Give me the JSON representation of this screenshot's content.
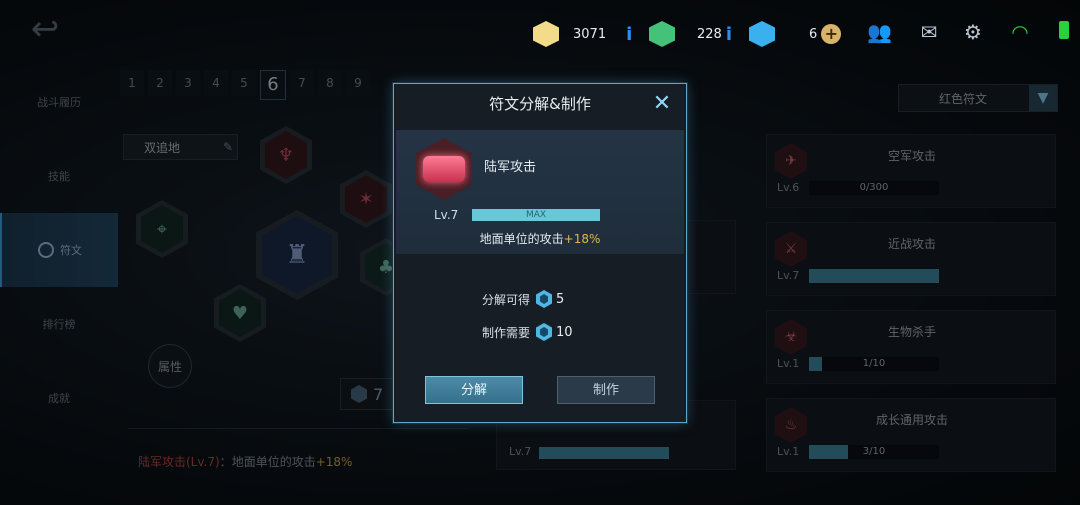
{
  "top_bar": {
    "gold_count": "3071",
    "jade_count": "228",
    "gem_count": "6",
    "info_glyph": "i",
    "icons": [
      "back-arrow-icon",
      "friends-icon",
      "mail-icon",
      "settings-gear-icon",
      "wifi-icon",
      "battery-icon"
    ]
  },
  "sidebar": {
    "items": [
      {
        "label": "战斗履历"
      },
      {
        "label": "技能"
      },
      {
        "label": "符文"
      },
      {
        "label": "排行榜"
      },
      {
        "label": "成就"
      }
    ],
    "active_index": 2
  },
  "pages": {
    "labels": [
      "1",
      "2",
      "3",
      "4",
      "5",
      "6",
      "7",
      "8",
      "9"
    ],
    "active": "6"
  },
  "loadout": {
    "name": "双追地"
  },
  "attribute_button": {
    "label": "属性"
  },
  "cost_badge": {
    "value": "7"
  },
  "description": {
    "rune": "陆军攻击(Lv.7)",
    "separator": "：",
    "text": "地面单位的攻击",
    "bonus": "+18%"
  },
  "filter": {
    "label": "红色符文"
  },
  "right_list": [
    {
      "name": "空军攻击",
      "level": "Lv.6",
      "progress_text": "0/300",
      "progress": 0.0
    },
    {
      "name": "近战攻击",
      "level": "Lv.7",
      "progress_text": "",
      "progress": 1.0
    },
    {
      "name": "生物杀手",
      "level": "Lv.1",
      "progress_text": "1/10",
      "progress": 0.1
    },
    {
      "name": "成长通用攻击",
      "level": "Lv.1",
      "progress_text": "3/10",
      "progress": 0.3
    }
  ],
  "mid_list": [
    {
      "level": "Lv.7"
    }
  ],
  "modal": {
    "title": "符文分解&制作",
    "rune_name": "陆军攻击",
    "level": "Lv.7",
    "bar_text": "MAX",
    "effect_text": "地面单位的攻击",
    "effect_bonus": "+18%",
    "decompose_label": "分解可得",
    "decompose_value": "5",
    "craft_label": "制作需要",
    "craft_value": "10",
    "decompose_button": "分解",
    "craft_button": "制作"
  },
  "colors": {
    "accent": "#5fa6c6",
    "highlight_gold": "#e0b453",
    "rune_red": "#c7324f",
    "bar_cyan": "#69c7d8"
  }
}
